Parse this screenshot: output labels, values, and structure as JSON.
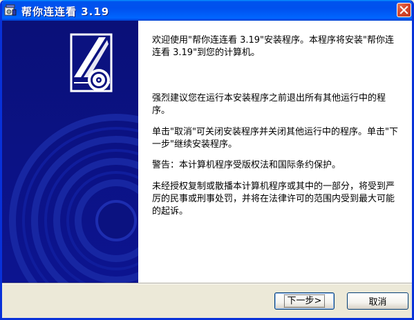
{
  "window": {
    "title": "帮你连连看  3.19"
  },
  "content": {
    "paragraphs": [
      "欢迎使用\"帮你连连看 3.19\"安装程序。本程序将安装\"帮你连连看 3.19\"到您的计算机。",
      "强烈建议您在运行本安装程序之前退出所有其他运行中的程序。",
      "单击\"取消\"可关闭安装程序并关闭其他运行中的程序。单击\"下一步\"继续安装程序。",
      "警告：本计算机程序受版权法和国际条约保护。",
      "未经授权复制或散播本计算机程序或其中的一部分，将受到严厉的民事或刑事处罚，并将在法律许可的范围内受到最大可能的起诉。"
    ]
  },
  "buttons": {
    "next": "下一步>",
    "cancel": "取消"
  },
  "icons": {
    "app": "installer-app-icon",
    "close": "close-icon",
    "banner": "installer-disc-graphic"
  },
  "colors": {
    "titlebar": "#0054e3",
    "banner": "#0b1280",
    "close": "#d8462b"
  }
}
